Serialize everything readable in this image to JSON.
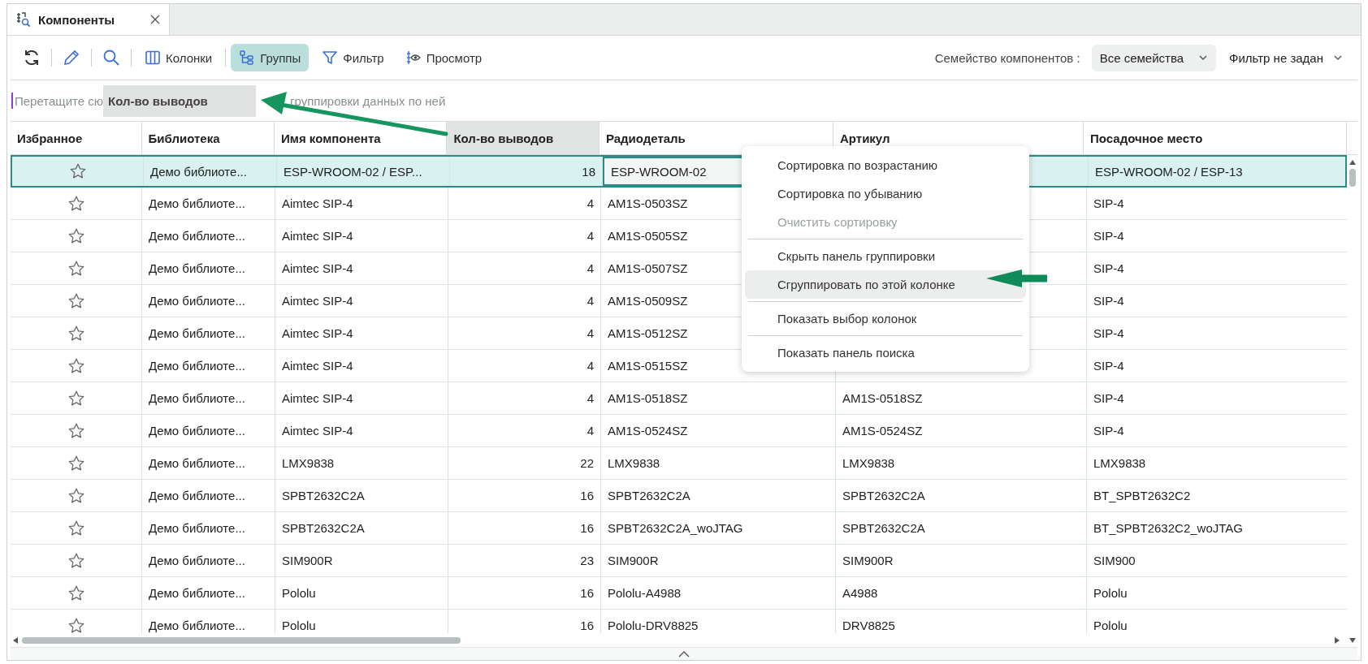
{
  "tab": {
    "title": "Компоненты",
    "selected": true
  },
  "toolbar": {
    "buttons": [
      {
        "label": "Колонки",
        "selected": false
      },
      {
        "label": "Группы",
        "selected": true
      },
      {
        "label": "Фильтр",
        "selected": false
      },
      {
        "label": "Просмотр",
        "selected": false
      }
    ],
    "family_label": "Семейство компонентов :",
    "family_value": "Все семейства",
    "filter_value": "Фильтр не задан"
  },
  "group_panel": {
    "placeholder_before": "Перетащите сю",
    "placeholder_after": "группировки данных по ней",
    "drag_ghost": "Кол-во выводов"
  },
  "table": {
    "columns": [
      {
        "label": "Избранное",
        "dragging": false
      },
      {
        "label": "Библиотека",
        "dragging": false
      },
      {
        "label": "Имя компонента",
        "dragging": false
      },
      {
        "label": "Кол-во выводов",
        "dragging": true
      },
      {
        "label": "Радиодеталь",
        "dragging": false
      },
      {
        "label": "Артикул",
        "dragging": false
      },
      {
        "label": "Посадочное место",
        "dragging": false
      }
    ],
    "rows": [
      {
        "favorite": false,
        "selected": true,
        "library": "Демо библиоте...",
        "name": "ESP-WROOM-02 / ESP...",
        "pins": "18",
        "part": "ESP-WROOM-02",
        "footprint": "ESP-WROOM-02 / ESP-13"
      },
      {
        "favorite": false,
        "selected": false,
        "library": "Демо библиоте...",
        "name": "Aimtec SIP-4",
        "pins": "4",
        "part": "AM1S-0503SZ",
        "footprint": "SIP-4"
      },
      {
        "favorite": false,
        "selected": false,
        "library": "Демо библиоте...",
        "name": "Aimtec SIP-4",
        "pins": "4",
        "part": "AM1S-0505SZ",
        "footprint": "SIP-4"
      },
      {
        "favorite": false,
        "selected": false,
        "library": "Демо библиоте...",
        "name": "Aimtec SIP-4",
        "pins": "4",
        "part": "AM1S-0507SZ",
        "footprint": "SIP-4"
      },
      {
        "favorite": false,
        "selected": false,
        "library": "Демо библиоте...",
        "name": "Aimtec SIP-4",
        "pins": "4",
        "part": "AM1S-0509SZ",
        "footprint": "SIP-4"
      },
      {
        "favorite": false,
        "selected": false,
        "library": "Демо библиоте...",
        "name": "Aimtec SIP-4",
        "pins": "4",
        "part": "AM1S-0512SZ",
        "footprint": "SIP-4"
      },
      {
        "favorite": false,
        "selected": false,
        "library": "Демо библиоте...",
        "name": "Aimtec SIP-4",
        "pins": "4",
        "part": "AM1S-0515SZ",
        "footprint": "SIP-4"
      },
      {
        "favorite": false,
        "selected": false,
        "library": "Демо библиоте...",
        "name": "Aimtec SIP-4",
        "pins": "4",
        "part": "AM1S-0518SZ",
        "article": "AM1S-0518SZ",
        "footprint": "SIP-4"
      },
      {
        "favorite": false,
        "selected": false,
        "library": "Демо библиоте...",
        "name": "Aimtec SIP-4",
        "pins": "4",
        "part": "AM1S-0524SZ",
        "article": "AM1S-0524SZ",
        "footprint": "SIP-4"
      },
      {
        "favorite": false,
        "selected": false,
        "library": "Демо библиоте...",
        "name": "LMX9838",
        "pins": "22",
        "part": "LMX9838",
        "article": "LMX9838",
        "footprint": "LMX9838"
      },
      {
        "favorite": false,
        "selected": false,
        "library": "Демо библиоте...",
        "name": "SPBT2632C2A",
        "pins": "16",
        "part": "SPBT2632C2A",
        "article": "SPBT2632C2A",
        "footprint": "BT_SPBT2632C2"
      },
      {
        "favorite": false,
        "selected": false,
        "library": "Демо библиоте...",
        "name": "SPBT2632C2A",
        "pins": "16",
        "part": "SPBT2632C2A_woJTAG",
        "article": "SPBT2632C2A",
        "footprint": "BT_SPBT2632C2_woJTAG"
      },
      {
        "favorite": false,
        "selected": false,
        "library": "Демо библиоте...",
        "name": "SIM900R",
        "pins": "23",
        "part": "SIM900R",
        "article": "SIM900R",
        "footprint": "SIM900"
      },
      {
        "favorite": false,
        "selected": false,
        "library": "Демо библиоте...",
        "name": "Pololu",
        "pins": "16",
        "part": "Pololu-A4988",
        "article": "A4988",
        "footprint": "Pololu"
      },
      {
        "favorite": false,
        "selected": false,
        "library": "Демо библиоте...",
        "name": "Pololu",
        "pins": "16",
        "part": "Pololu-DRV8825",
        "article": "DRV8825",
        "footprint": "Pololu"
      }
    ]
  },
  "context_menu": {
    "groups": [
      [
        {
          "label": "Сортировка по возрастанию",
          "disabled": false,
          "selected": false
        },
        {
          "label": "Сортировка по убыванию",
          "disabled": false,
          "selected": false
        },
        {
          "label": "Очистить сортировку",
          "disabled": true,
          "selected": false
        }
      ],
      [
        {
          "label": "Скрыть панель группировки",
          "disabled": false,
          "selected": false
        },
        {
          "label": "Сгруппировать по этой колонке",
          "disabled": false,
          "selected": true
        }
      ],
      [
        {
          "label": "Показать выбор колонок",
          "disabled": false,
          "selected": false
        }
      ],
      [
        {
          "label": "Показать панель поиска",
          "disabled": false,
          "selected": false
        }
      ]
    ]
  }
}
